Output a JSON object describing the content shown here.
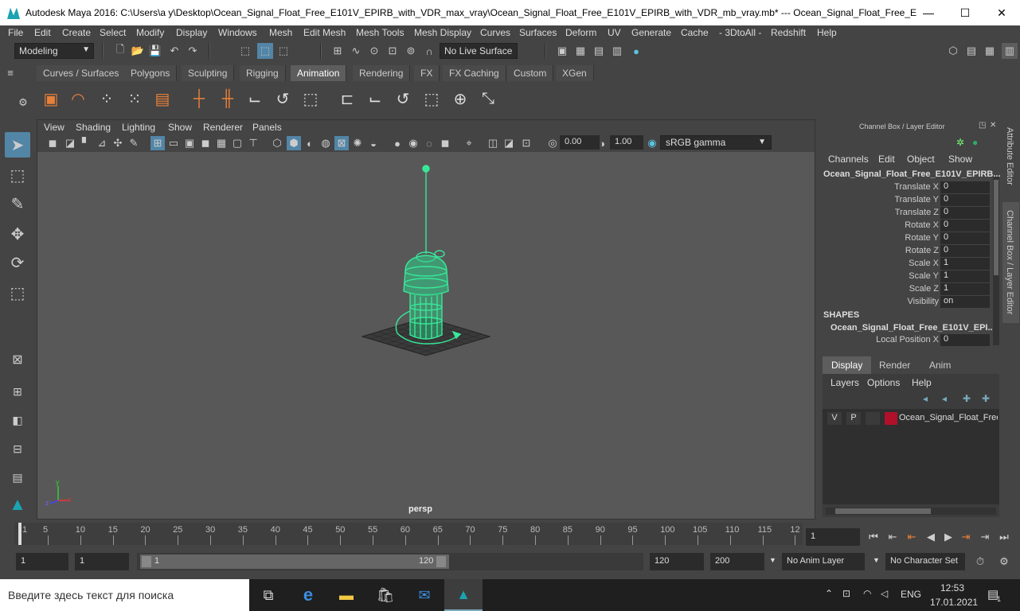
{
  "window": {
    "title": "Autodesk Maya 2016: C:\\Users\\a y\\Desktop\\Ocean_Signal_Float_Free_E101V_EPIRB_with_VDR_max_vray\\Ocean_Signal_Float_Free_E101V_EPIRB_with_VDR_mb_vray.mb*  ---  Ocean_Signal_Float_Free_E101V_EPI...",
    "min": "—",
    "max": "☐",
    "close": "✕"
  },
  "menubar": [
    "File",
    "Edit",
    "Create",
    "Select",
    "Modify",
    "Display",
    "Windows",
    "Mesh",
    "Edit Mesh",
    "Mesh Tools",
    "Mesh Display",
    "Curves",
    "Surfaces",
    "Deform",
    "UV",
    "Generate",
    "Cache",
    "- 3DtoAll -",
    "Redshift",
    "Help"
  ],
  "statusline": {
    "mode": "Modeling",
    "live_surface": "No Live Surface"
  },
  "shelf_tabs": [
    "Curves / Surfaces",
    "Polygons",
    "Sculpting",
    "Rigging",
    "Animation",
    "Rendering",
    "FX",
    "FX Caching",
    "Custom",
    "XGen"
  ],
  "shelf_active": "Animation",
  "viewport": {
    "menu": [
      "View",
      "Shading",
      "Lighting",
      "Show",
      "Renderer",
      "Panels"
    ],
    "exposure": "0.00",
    "gamma": "1.00",
    "colorspace": "sRGB gamma",
    "camera": "persp",
    "axis_x": "x",
    "axis_y": "y",
    "axis_z": "z"
  },
  "channelbox": {
    "header": "Channel Box / Layer Editor",
    "menu": [
      "Channels",
      "Edit",
      "Object",
      "Show"
    ],
    "object": "Ocean_Signal_Float_Free_E101V_EPIRB...",
    "channels": [
      {
        "label": "Translate X",
        "value": "0"
      },
      {
        "label": "Translate Y",
        "value": "0"
      },
      {
        "label": "Translate Z",
        "value": "0"
      },
      {
        "label": "Rotate X",
        "value": "0"
      },
      {
        "label": "Rotate Y",
        "value": "0"
      },
      {
        "label": "Rotate Z",
        "value": "0"
      },
      {
        "label": "Scale X",
        "value": "1"
      },
      {
        "label": "Scale Y",
        "value": "1"
      },
      {
        "label": "Scale Z",
        "value": "1"
      },
      {
        "label": "Visibility",
        "value": "on"
      }
    ],
    "shapes_title": "SHAPES",
    "shape_name": "Ocean_Signal_Float_Free_E101V_EPI...",
    "shape_channel": {
      "label": "Local Position X",
      "value": "0"
    }
  },
  "layer_editor": {
    "tabs": [
      "Display",
      "Render",
      "Anim"
    ],
    "menu": [
      "Layers",
      "Options",
      "Help"
    ],
    "layer": {
      "v": "V",
      "p": "P",
      "name": "Ocean_Signal_Float_Free",
      "color": "#b0102a"
    }
  },
  "side_tabs": {
    "attribute": "Attribute Editor",
    "channel": "Channel Box / Layer Editor"
  },
  "timeline": {
    "ticks": [
      "5",
      "10",
      "15",
      "20",
      "25",
      "30",
      "35",
      "40",
      "45",
      "50",
      "55",
      "60",
      "65",
      "70",
      "75",
      "80",
      "85",
      "90",
      "95",
      "100",
      "105",
      "110",
      "115",
      "12"
    ],
    "start_mark": "1",
    "current_frame": "1"
  },
  "range": {
    "start": "1",
    "range_start": "1",
    "slider_start": "1",
    "slider_end": "120",
    "range_end": "120",
    "end": "200",
    "anim_layer": "No Anim Layer",
    "character_set": "No Character Set"
  },
  "taskbar": {
    "search": "Введите здесь текст для поиска",
    "lang": "ENG",
    "time": "12:53",
    "date": "17.01.2021",
    "notif_count": "1"
  },
  "colors": {
    "accent": "#5285a6",
    "mesh": "#38e89a",
    "bg": "#444444"
  }
}
